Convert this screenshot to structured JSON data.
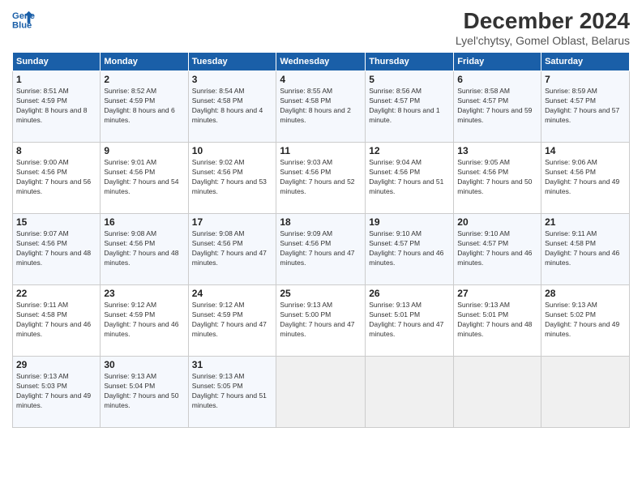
{
  "header": {
    "logo_line1": "General",
    "logo_line2": "Blue",
    "title": "December 2024",
    "subtitle": "Lyel'chytsy, Gomel Oblast, Belarus"
  },
  "weekdays": [
    "Sunday",
    "Monday",
    "Tuesday",
    "Wednesday",
    "Thursday",
    "Friday",
    "Saturday"
  ],
  "weeks": [
    [
      {
        "day": "1",
        "sunrise": "Sunrise: 8:51 AM",
        "sunset": "Sunset: 4:59 PM",
        "daylight": "Daylight: 8 hours and 8 minutes."
      },
      {
        "day": "2",
        "sunrise": "Sunrise: 8:52 AM",
        "sunset": "Sunset: 4:59 PM",
        "daylight": "Daylight: 8 hours and 6 minutes."
      },
      {
        "day": "3",
        "sunrise": "Sunrise: 8:54 AM",
        "sunset": "Sunset: 4:58 PM",
        "daylight": "Daylight: 8 hours and 4 minutes."
      },
      {
        "day": "4",
        "sunrise": "Sunrise: 8:55 AM",
        "sunset": "Sunset: 4:58 PM",
        "daylight": "Daylight: 8 hours and 2 minutes."
      },
      {
        "day": "5",
        "sunrise": "Sunrise: 8:56 AM",
        "sunset": "Sunset: 4:57 PM",
        "daylight": "Daylight: 8 hours and 1 minute."
      },
      {
        "day": "6",
        "sunrise": "Sunrise: 8:58 AM",
        "sunset": "Sunset: 4:57 PM",
        "daylight": "Daylight: 7 hours and 59 minutes."
      },
      {
        "day": "7",
        "sunrise": "Sunrise: 8:59 AM",
        "sunset": "Sunset: 4:57 PM",
        "daylight": "Daylight: 7 hours and 57 minutes."
      }
    ],
    [
      {
        "day": "8",
        "sunrise": "Sunrise: 9:00 AM",
        "sunset": "Sunset: 4:56 PM",
        "daylight": "Daylight: 7 hours and 56 minutes."
      },
      {
        "day": "9",
        "sunrise": "Sunrise: 9:01 AM",
        "sunset": "Sunset: 4:56 PM",
        "daylight": "Daylight: 7 hours and 54 minutes."
      },
      {
        "day": "10",
        "sunrise": "Sunrise: 9:02 AM",
        "sunset": "Sunset: 4:56 PM",
        "daylight": "Daylight: 7 hours and 53 minutes."
      },
      {
        "day": "11",
        "sunrise": "Sunrise: 9:03 AM",
        "sunset": "Sunset: 4:56 PM",
        "daylight": "Daylight: 7 hours and 52 minutes."
      },
      {
        "day": "12",
        "sunrise": "Sunrise: 9:04 AM",
        "sunset": "Sunset: 4:56 PM",
        "daylight": "Daylight: 7 hours and 51 minutes."
      },
      {
        "day": "13",
        "sunrise": "Sunrise: 9:05 AM",
        "sunset": "Sunset: 4:56 PM",
        "daylight": "Daylight: 7 hours and 50 minutes."
      },
      {
        "day": "14",
        "sunrise": "Sunrise: 9:06 AM",
        "sunset": "Sunset: 4:56 PM",
        "daylight": "Daylight: 7 hours and 49 minutes."
      }
    ],
    [
      {
        "day": "15",
        "sunrise": "Sunrise: 9:07 AM",
        "sunset": "Sunset: 4:56 PM",
        "daylight": "Daylight: 7 hours and 48 minutes."
      },
      {
        "day": "16",
        "sunrise": "Sunrise: 9:08 AM",
        "sunset": "Sunset: 4:56 PM",
        "daylight": "Daylight: 7 hours and 48 minutes."
      },
      {
        "day": "17",
        "sunrise": "Sunrise: 9:08 AM",
        "sunset": "Sunset: 4:56 PM",
        "daylight": "Daylight: 7 hours and 47 minutes."
      },
      {
        "day": "18",
        "sunrise": "Sunrise: 9:09 AM",
        "sunset": "Sunset: 4:56 PM",
        "daylight": "Daylight: 7 hours and 47 minutes."
      },
      {
        "day": "19",
        "sunrise": "Sunrise: 9:10 AM",
        "sunset": "Sunset: 4:57 PM",
        "daylight": "Daylight: 7 hours and 46 minutes."
      },
      {
        "day": "20",
        "sunrise": "Sunrise: 9:10 AM",
        "sunset": "Sunset: 4:57 PM",
        "daylight": "Daylight: 7 hours and 46 minutes."
      },
      {
        "day": "21",
        "sunrise": "Sunrise: 9:11 AM",
        "sunset": "Sunset: 4:58 PM",
        "daylight": "Daylight: 7 hours and 46 minutes."
      }
    ],
    [
      {
        "day": "22",
        "sunrise": "Sunrise: 9:11 AM",
        "sunset": "Sunset: 4:58 PM",
        "daylight": "Daylight: 7 hours and 46 minutes."
      },
      {
        "day": "23",
        "sunrise": "Sunrise: 9:12 AM",
        "sunset": "Sunset: 4:59 PM",
        "daylight": "Daylight: 7 hours and 46 minutes."
      },
      {
        "day": "24",
        "sunrise": "Sunrise: 9:12 AM",
        "sunset": "Sunset: 4:59 PM",
        "daylight": "Daylight: 7 hours and 47 minutes."
      },
      {
        "day": "25",
        "sunrise": "Sunrise: 9:13 AM",
        "sunset": "Sunset: 5:00 PM",
        "daylight": "Daylight: 7 hours and 47 minutes."
      },
      {
        "day": "26",
        "sunrise": "Sunrise: 9:13 AM",
        "sunset": "Sunset: 5:01 PM",
        "daylight": "Daylight: 7 hours and 47 minutes."
      },
      {
        "day": "27",
        "sunrise": "Sunrise: 9:13 AM",
        "sunset": "Sunset: 5:01 PM",
        "daylight": "Daylight: 7 hours and 48 minutes."
      },
      {
        "day": "28",
        "sunrise": "Sunrise: 9:13 AM",
        "sunset": "Sunset: 5:02 PM",
        "daylight": "Daylight: 7 hours and 49 minutes."
      }
    ],
    [
      {
        "day": "29",
        "sunrise": "Sunrise: 9:13 AM",
        "sunset": "Sunset: 5:03 PM",
        "daylight": "Daylight: 7 hours and 49 minutes."
      },
      {
        "day": "30",
        "sunrise": "Sunrise: 9:13 AM",
        "sunset": "Sunset: 5:04 PM",
        "daylight": "Daylight: 7 hours and 50 minutes."
      },
      {
        "day": "31",
        "sunrise": "Sunrise: 9:13 AM",
        "sunset": "Sunset: 5:05 PM",
        "daylight": "Daylight: 7 hours and 51 minutes."
      },
      null,
      null,
      null,
      null
    ]
  ]
}
